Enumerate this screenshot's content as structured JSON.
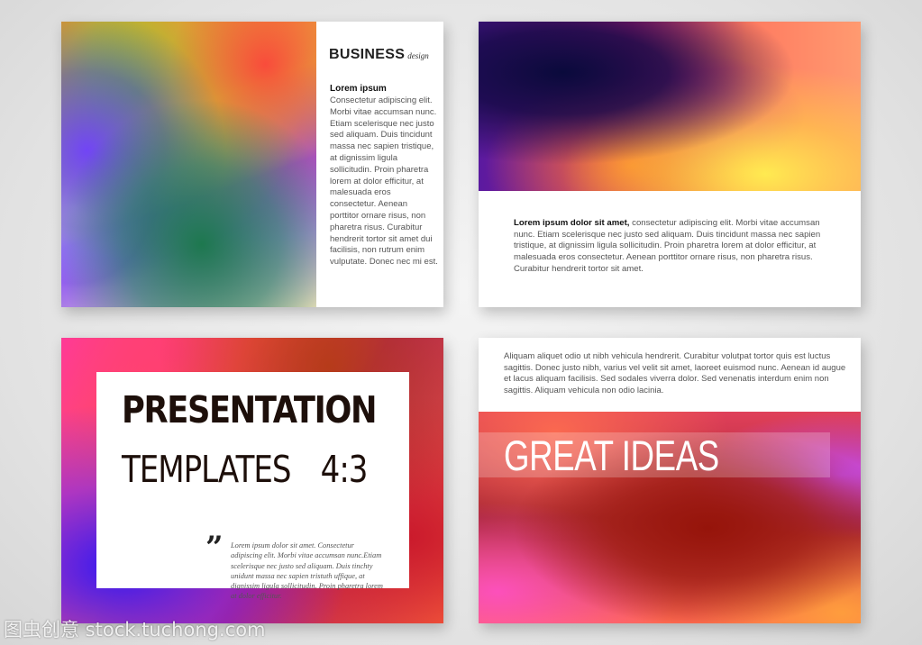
{
  "slide1": {
    "title": "BUSINESS",
    "subtitle": "design",
    "heading": "Lorem ipsum",
    "body": "Consectetur adipiscing elit. Morbi vitae accumsan nunc. Etiam scelerisque nec justo sed aliquam. Duis tincidunt massa nec sapien tristique, at dignissim ligula sollicitudin. Proin pharetra lorem at dolor efficitur, at malesuada eros consectetur. Aenean porttitor ornare risus, non pharetra risus. Curabitur hendrerit tortor sit amet dui facilisis, non rutrum enim vulputate. Donec nec mi est."
  },
  "slide2": {
    "lead": "Lorem ipsum dolor sit amet,",
    "body": " consectetur adipiscing elit. Morbi vitae accumsan nunc. Etiam scelerisque nec justo sed aliquam. Duis tincidunt massa nec sapien tristique, at dignissim ligula sollicitudin. Proin pharetra lorem at dolor efficitur, at malesuada eros consectetur. Aenean porttitor ornare risus, non pharetra risus. Curabitur hendrerit tortor sit amet."
  },
  "slide3": {
    "title_line1": "PRESENTATION",
    "title_line2_a": "TEMPLATES",
    "title_line2_b": "4:3",
    "quote_mark": "”",
    "quote_text": "Lorem ipsum dolor sit amet. Consectetur adipiscing elit. Morbi vitae accumsan nunc.Etiam scelerisque nec justo sed aliquam. Duis tinchty unidunt massa nec sapien tristuth uffique, at dignissim ligula sollicitudin. Proin pharetra lorem at dolor efficitur."
  },
  "slide4": {
    "body": "Aliquam aliquet odio ut nibh vehicula hendrerit. Curabitur volutpat tortor quis est luctus sagittis. Donec justo nibh, varius vel velit sit amet, laoreet euismod nunc. Aenean id augue et lacus aliquam facilisis. Sed sodales viverra dolor. Sed venenatis interdum enim non sagittis. Aliquam vehicula non odio lacinia.",
    "title": "GREAT IDEAS"
  },
  "watermark": "图虫创意 stock.tuchong.com"
}
